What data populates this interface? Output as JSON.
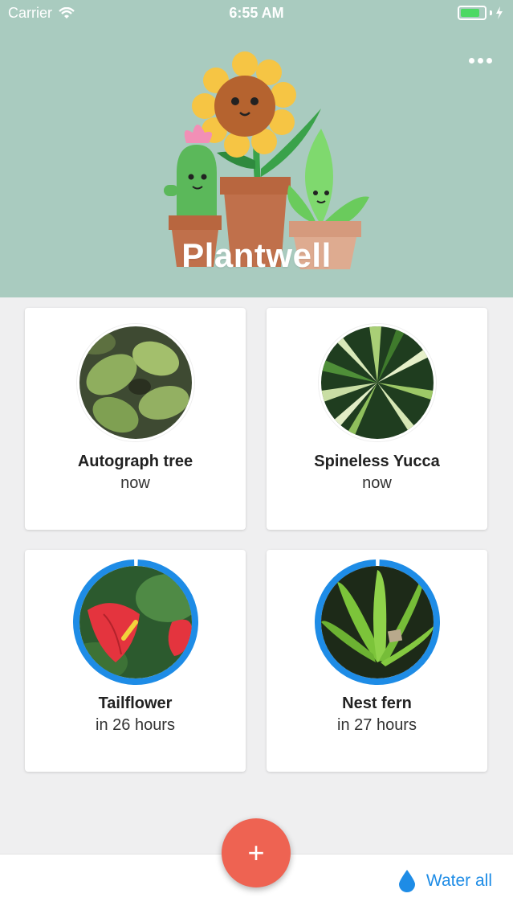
{
  "status_bar": {
    "carrier": "Carrier",
    "time": "6:55 AM",
    "battery_level": 0.9
  },
  "header": {
    "title": "Plantwell",
    "background": "#a9cbbf",
    "more_icon": "more-horizontal-icon"
  },
  "plants": [
    {
      "name": "Autograph tree",
      "due": "now",
      "watering_progress": 0
    },
    {
      "name": "Spineless Yucca",
      "due": "now",
      "watering_progress": 0
    },
    {
      "name": "Tailflower",
      "due": "in 26 hours",
      "watering_progress": 0.99
    },
    {
      "name": "Nest fern",
      "due": "in 27 hours",
      "watering_progress": 0.99
    }
  ],
  "actions": {
    "add_icon": "plus-icon",
    "add_color": "#ee6352",
    "water_all_label": "Water all",
    "water_icon": "water-drop-icon",
    "accent": "#1e8ce6"
  }
}
